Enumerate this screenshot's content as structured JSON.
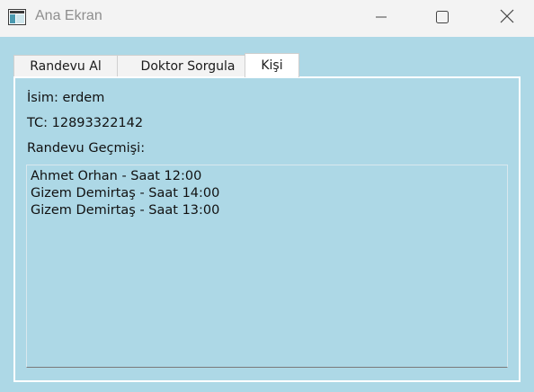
{
  "window": {
    "title": "Ana Ekran",
    "icon": "app-window-icon",
    "controls": {
      "minimize_icon": "minimize-icon",
      "maximize_icon": "maximize-icon",
      "close_icon": "close-icon"
    }
  },
  "tabs": [
    {
      "label": "Randevu Al",
      "selected": false
    },
    {
      "label": "Doktor Sorgula",
      "selected": false
    },
    {
      "label": "Kişi",
      "selected": true
    }
  ],
  "person": {
    "name_line": "İsim: erdem",
    "tc_line": "TC: 12893322142",
    "history_label": "Randevu Geçmişi:",
    "history": [
      "Ahmet Orhan - Saat 12:00",
      "Gizem Demirtaş - Saat 14:00",
      "Gizem Demirtaş - Saat 13:00"
    ]
  },
  "colors": {
    "background": "#add8e6",
    "titlebar": "#f3f3f3"
  }
}
